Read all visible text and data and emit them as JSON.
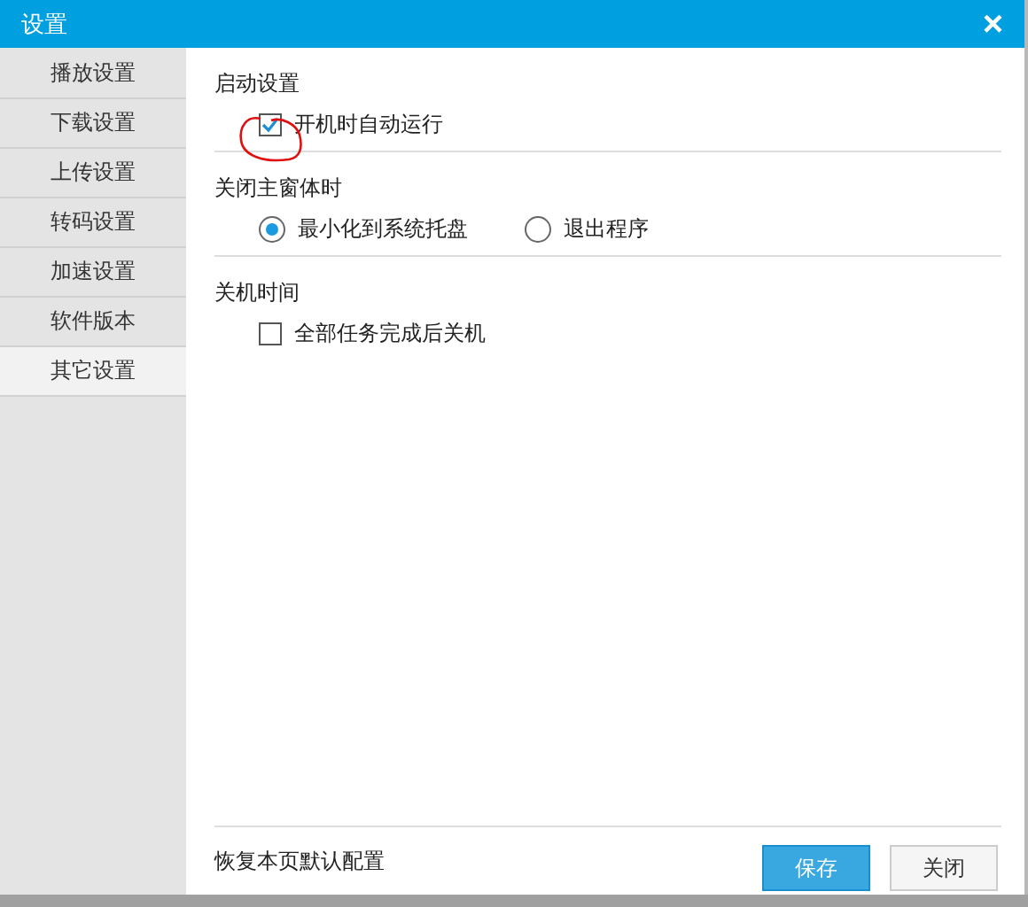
{
  "window": {
    "title": "设置",
    "close": "×"
  },
  "sidebar": {
    "items": [
      {
        "label": "播放设置",
        "selected": false
      },
      {
        "label": "下载设置",
        "selected": false
      },
      {
        "label": "上传设置",
        "selected": false
      },
      {
        "label": "转码设置",
        "selected": false
      },
      {
        "label": "加速设置",
        "selected": false
      },
      {
        "label": "软件版本",
        "selected": false
      },
      {
        "label": "其它设置",
        "selected": true
      }
    ]
  },
  "sections": [
    {
      "title": "启动设置",
      "options": [
        {
          "kind": "checkbox",
          "label": "开机时自动运行",
          "checked": true
        }
      ]
    },
    {
      "title": "关闭主窗体时",
      "options": [
        {
          "kind": "radio",
          "label": "最小化到系统托盘",
          "selected": true
        },
        {
          "kind": "radio",
          "label": "退出程序",
          "selected": false
        }
      ]
    },
    {
      "title": "关机时间",
      "options": [
        {
          "kind": "checkbox",
          "label": "全部任务完成后关机",
          "checked": false
        }
      ]
    }
  ],
  "footer": {
    "restore_link": "恢复本页默认配置",
    "buttons": [
      {
        "label": "保存",
        "primary": true
      },
      {
        "label": "关闭",
        "primary": false
      }
    ]
  }
}
